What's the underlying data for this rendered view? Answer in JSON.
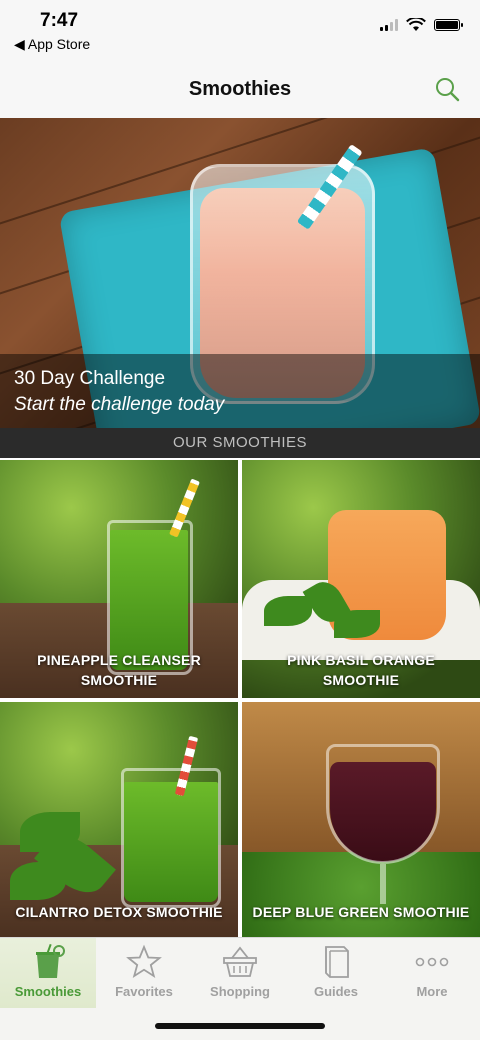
{
  "status_bar": {
    "time": "7:47",
    "back_label": "◀ App Store"
  },
  "nav": {
    "title": "Smoothies",
    "search_icon": "search-icon"
  },
  "hero": {
    "title": "30 Day Challenge",
    "subtitle": "Start the challenge today"
  },
  "section": {
    "header": "OUR SMOOTHIES"
  },
  "tiles": [
    {
      "label_line1": "PINEAPPLE CLEANSER",
      "label_line2": "SMOOTHIE"
    },
    {
      "label_line1": "PINK BASIL ORANGE",
      "label_line2": "SMOOTHIE"
    },
    {
      "label_line1": "CILANTRO DETOX SMOOTHIE"
    },
    {
      "label_line1": "DEEP BLUE GREEN SMOOTHIE"
    }
  ],
  "tabs": [
    {
      "label": "Smoothies",
      "icon": "smoothie-glass-icon",
      "active": true
    },
    {
      "label": "Favorites",
      "icon": "star-icon",
      "active": false
    },
    {
      "label": "Shopping",
      "icon": "basket-icon",
      "active": false
    },
    {
      "label": "Guides",
      "icon": "book-icon",
      "active": false
    },
    {
      "label": "More",
      "icon": "more-dots-icon",
      "active": false
    }
  ],
  "colors": {
    "accent": "#4a9a38",
    "tab_inactive": "#a0a0a0",
    "section_bg": "#2b2b2b"
  }
}
